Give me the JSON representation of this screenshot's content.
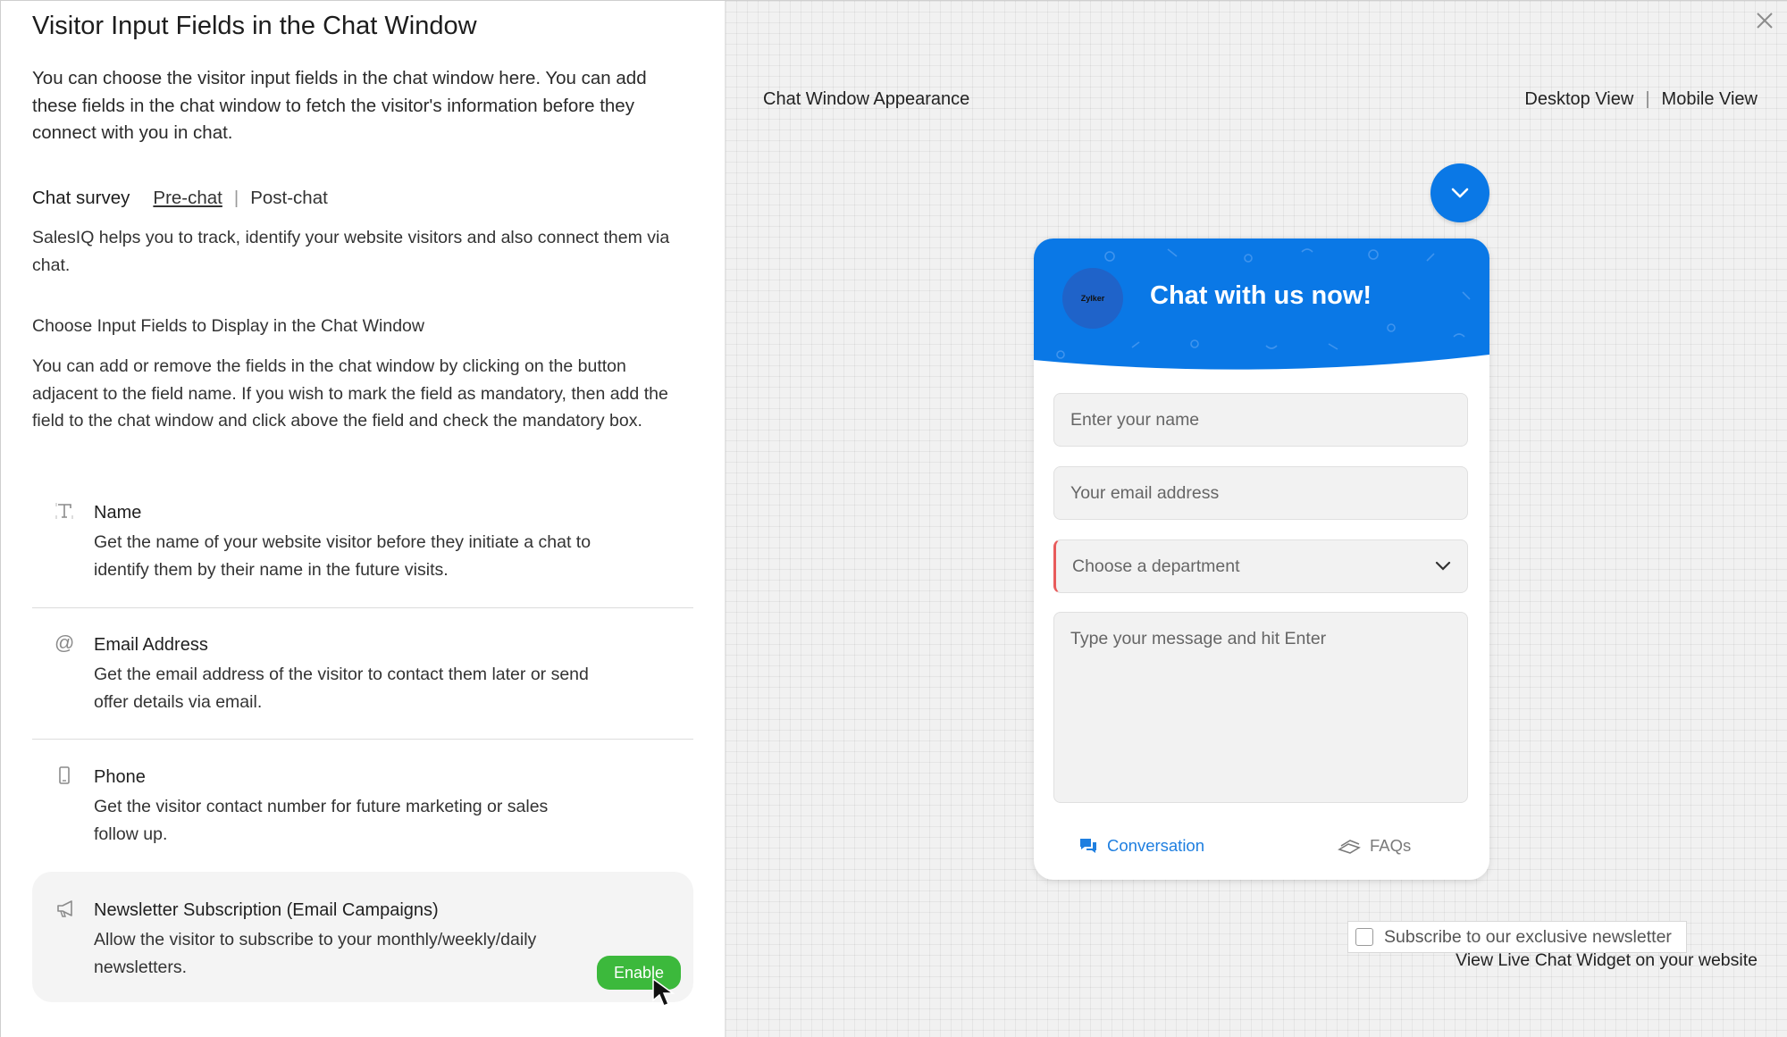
{
  "left": {
    "title": "Visitor Input Fields in the Chat Window",
    "intro": "You can choose the visitor input fields in the chat window here. You can add these fields in the chat window to fetch the visitor's information before they connect with you in chat.",
    "survey": {
      "label": "Chat survey",
      "tabs": [
        "Pre-chat",
        "Post-chat"
      ],
      "active": "Pre-chat"
    },
    "track_text": "SalesIQ helps you to track, identify your website visitors and also connect them via chat.",
    "choose_title": "Choose Input Fields to Display in the Chat Window",
    "choose_desc": "You can add or remove the fields in the chat window by clicking on the button adjacent to the field name. If you wish to mark the field as mandatory, then add the field to the chat window and click above the field and check the mandatory box.",
    "fields": [
      {
        "icon": "text-field-icon",
        "name": "Name",
        "desc": "Get the name of your website visitor before they initiate a chat to identify them by their name in the future visits."
      },
      {
        "icon": "at-sign-icon",
        "name": "Email Address",
        "desc": "Get the email address of the visitor to contact them later or send offer details via email."
      },
      {
        "icon": "phone-icon",
        "name": "Phone",
        "desc": "Get the visitor contact number for future marketing or sales follow up."
      },
      {
        "icon": "megaphone-icon",
        "name": "Newsletter Subscription (Email Campaigns)",
        "desc": "Allow the visitor to subscribe to your monthly/weekly/daily newsletters.",
        "button": "Enable"
      }
    ]
  },
  "right": {
    "appearance_title": "Chat Window Appearance",
    "views": [
      "Desktop View",
      "Mobile View"
    ],
    "chat": {
      "title": "Chat with us now!",
      "avatar_text": "Zylker",
      "name_placeholder": "Enter your name",
      "email_placeholder": "Your email address",
      "department_placeholder": "Choose a department",
      "message_placeholder": "Type your message and hit Enter",
      "tabs": [
        "Conversation",
        "FAQs"
      ]
    },
    "newsletter_checkbox": "Subscribe to our exclusive newsletter",
    "view_live": "View Live Chat Widget on your website"
  },
  "colors": {
    "accent": "#0a78e6",
    "enable_green": "#3cb93c",
    "mandatory_red": "#e85b5b",
    "tab_active": "#1f7fe0"
  }
}
